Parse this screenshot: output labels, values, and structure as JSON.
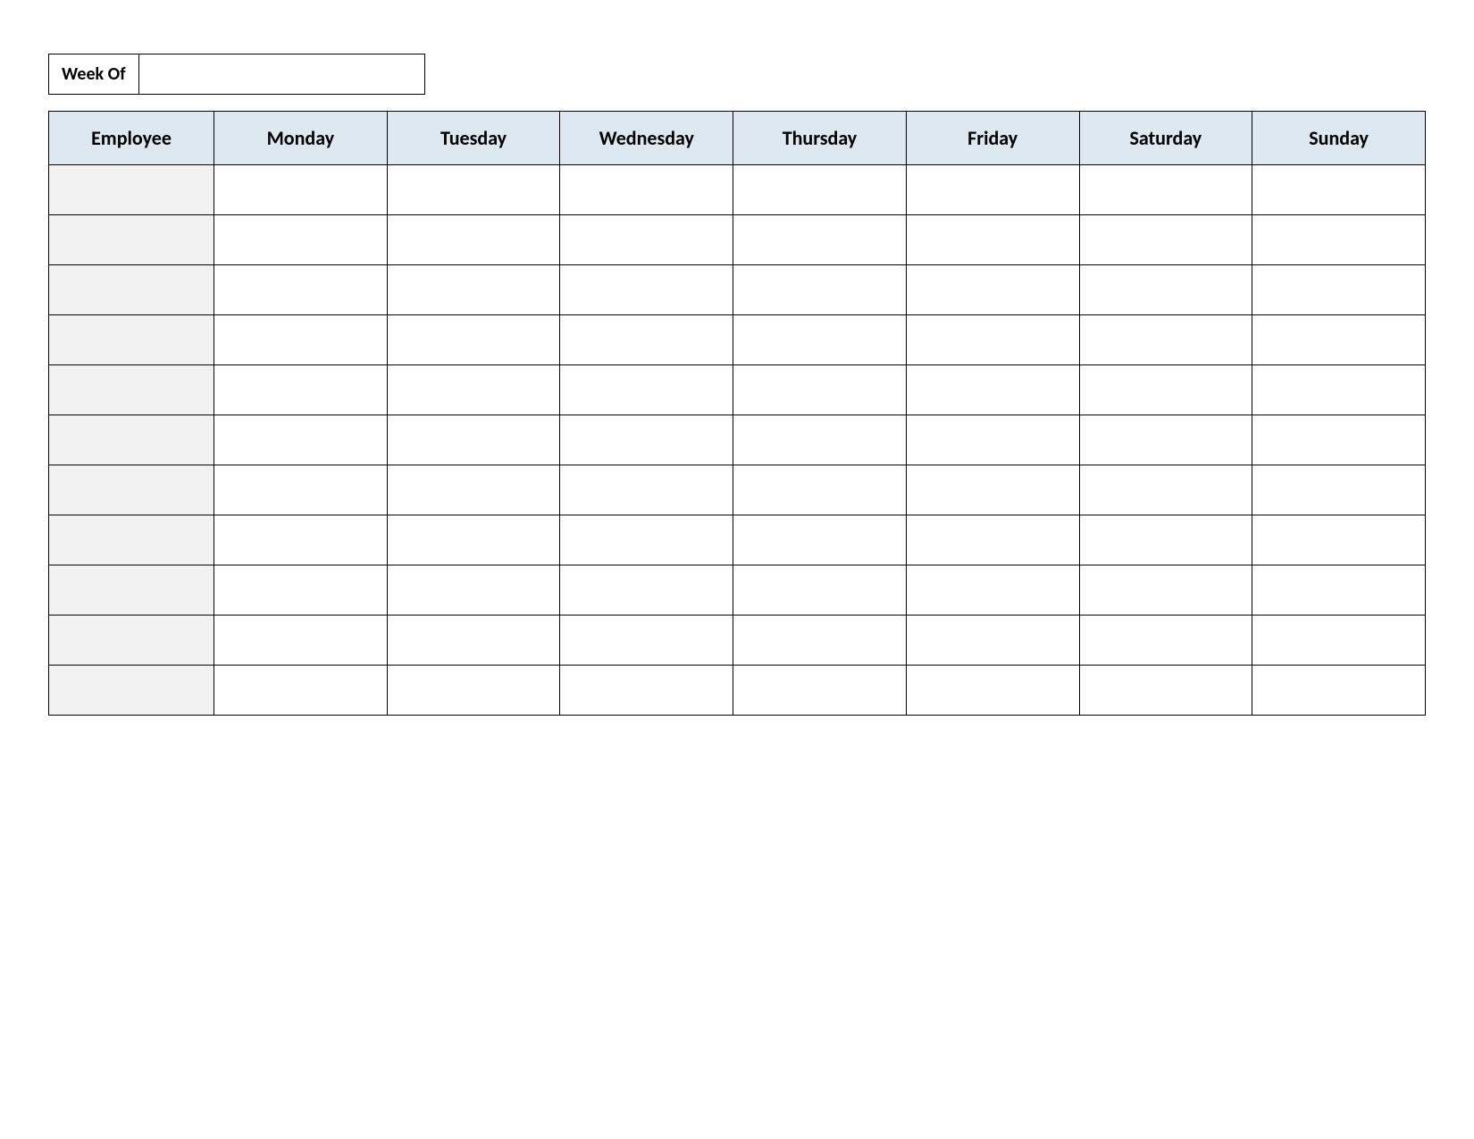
{
  "week_of": {
    "label": "Week Of",
    "value": ""
  },
  "table": {
    "headers": [
      "Employee",
      "Monday",
      "Tuesday",
      "Wednesday",
      "Thursday",
      "Friday",
      "Saturday",
      "Sunday"
    ],
    "rows": [
      {
        "employee": "",
        "monday": "",
        "tuesday": "",
        "wednesday": "",
        "thursday": "",
        "friday": "",
        "saturday": "",
        "sunday": ""
      },
      {
        "employee": "",
        "monday": "",
        "tuesday": "",
        "wednesday": "",
        "thursday": "",
        "friday": "",
        "saturday": "",
        "sunday": ""
      },
      {
        "employee": "",
        "monday": "",
        "tuesday": "",
        "wednesday": "",
        "thursday": "",
        "friday": "",
        "saturday": "",
        "sunday": ""
      },
      {
        "employee": "",
        "monday": "",
        "tuesday": "",
        "wednesday": "",
        "thursday": "",
        "friday": "",
        "saturday": "",
        "sunday": ""
      },
      {
        "employee": "",
        "monday": "",
        "tuesday": "",
        "wednesday": "",
        "thursday": "",
        "friday": "",
        "saturday": "",
        "sunday": ""
      },
      {
        "employee": "",
        "monday": "",
        "tuesday": "",
        "wednesday": "",
        "thursday": "",
        "friday": "",
        "saturday": "",
        "sunday": ""
      },
      {
        "employee": "",
        "monday": "",
        "tuesday": "",
        "wednesday": "",
        "thursday": "",
        "friday": "",
        "saturday": "",
        "sunday": ""
      },
      {
        "employee": "",
        "monday": "",
        "tuesday": "",
        "wednesday": "",
        "thursday": "",
        "friday": "",
        "saturday": "",
        "sunday": ""
      },
      {
        "employee": "",
        "monday": "",
        "tuesday": "",
        "wednesday": "",
        "thursday": "",
        "friday": "",
        "saturday": "",
        "sunday": ""
      },
      {
        "employee": "",
        "monday": "",
        "tuesday": "",
        "wednesday": "",
        "thursday": "",
        "friday": "",
        "saturday": "",
        "sunday": ""
      },
      {
        "employee": "",
        "monday": "",
        "tuesday": "",
        "wednesday": "",
        "thursday": "",
        "friday": "",
        "saturday": "",
        "sunday": ""
      }
    ]
  }
}
